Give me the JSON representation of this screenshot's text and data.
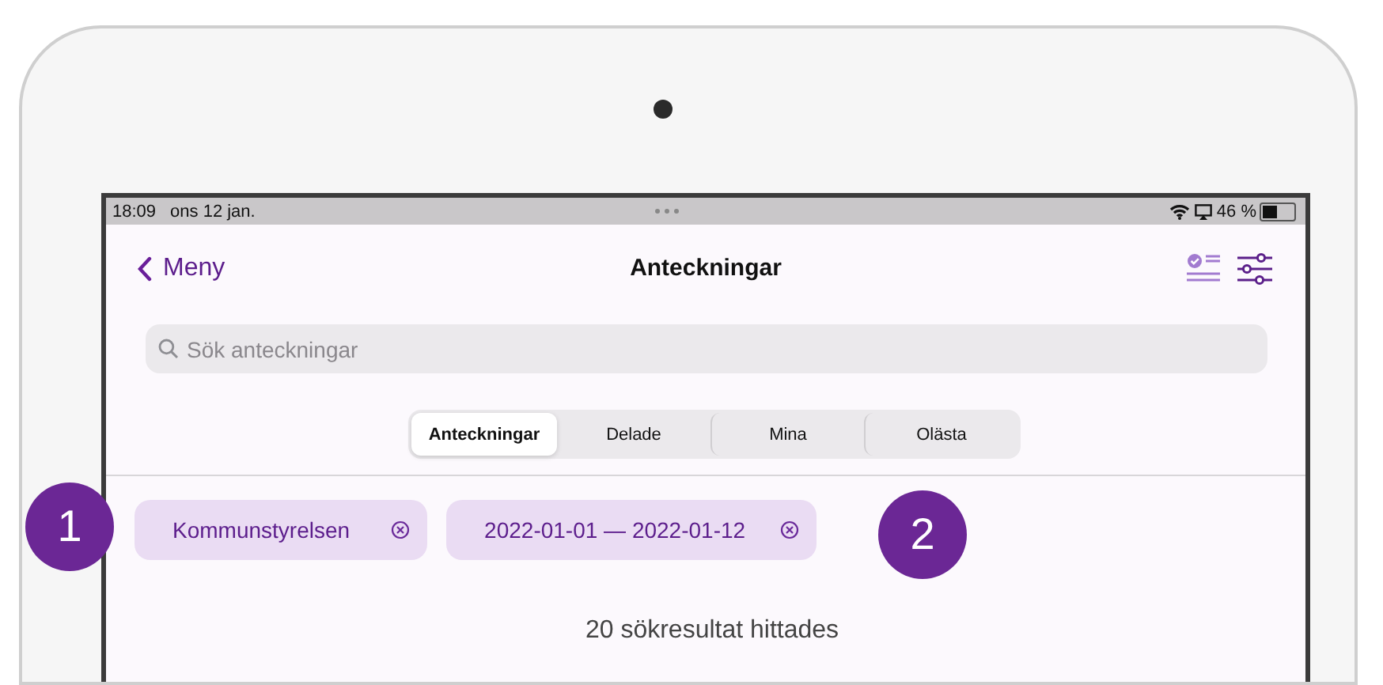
{
  "status_bar": {
    "time": "18:09",
    "date": "ons 12 jan.",
    "battery": "46 %"
  },
  "nav": {
    "back": "Meny",
    "title": "Anteckningar"
  },
  "search": {
    "placeholder": "Sök anteckningar"
  },
  "segments": [
    {
      "label": "Anteckningar",
      "selected": true
    },
    {
      "label": "Delade",
      "selected": false
    },
    {
      "label": "Mina",
      "selected": false
    },
    {
      "label": "Olästa",
      "selected": false
    }
  ],
  "filter_chips": [
    {
      "label": "Kommunstyrelsen"
    },
    {
      "label": "2022-01-01 — 2022-01-12"
    }
  ],
  "callouts": [
    "1",
    "2"
  ],
  "result_text": "20 sökresultat hittades"
}
